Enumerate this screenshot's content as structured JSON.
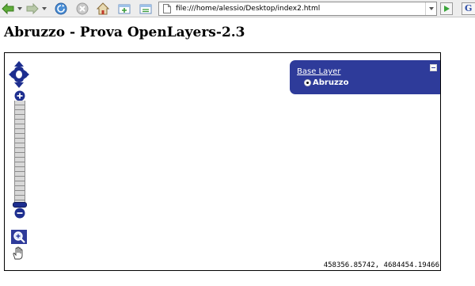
{
  "browser": {
    "url": "file:///home/alessio/Desktop/index2.html",
    "search_engine_glyph": "G",
    "icons": {
      "back": "back-arrow-icon",
      "forward": "forward-arrow-icon",
      "reload": "reload-icon",
      "stop": "stop-icon",
      "home": "home-icon",
      "new_tab": "new-tab-icon",
      "tab_list": "tab-list-icon",
      "page": "page-icon",
      "go": "go-icon"
    }
  },
  "page": {
    "title": "Abruzzo - Prova OpenLayers-2.3"
  },
  "map": {
    "layer_switcher": {
      "header": "Base Layer",
      "layers": [
        {
          "label": "Abruzzo",
          "selected": true
        }
      ]
    },
    "mouse_position": "458356.85742, 4684454.19466"
  },
  "colors": {
    "control_blue": "#2e3b9a",
    "panzoom_blue": "#1d2e8f",
    "toolbar_bg": "#ededed"
  }
}
